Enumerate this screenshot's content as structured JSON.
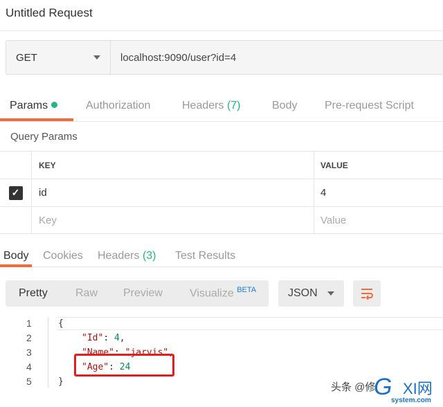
{
  "title": "Untitled Request",
  "request": {
    "method": "GET",
    "url": "localhost:9090/user?id=4"
  },
  "tabs": [
    {
      "label": "Params"
    },
    {
      "label": "Authorization"
    },
    {
      "label": "Headers",
      "count": "(7)"
    },
    {
      "label": "Body"
    },
    {
      "label": "Pre-request Script"
    }
  ],
  "query_params": {
    "title": "Query Params",
    "columns": [
      "KEY",
      "VALUE"
    ],
    "rows": [
      {
        "checked": true,
        "key": "id",
        "value": "4"
      }
    ],
    "placeholder": {
      "key": "Key",
      "value": "Value"
    }
  },
  "response_tabs": [
    {
      "label": "Body"
    },
    {
      "label": "Cookies"
    },
    {
      "label": "Headers",
      "count": "(3)"
    },
    {
      "label": "Test Results"
    }
  ],
  "view_modes": [
    "Pretty",
    "Raw",
    "Preview",
    "Visualize"
  ],
  "beta": "BETA",
  "format": "JSON",
  "code": {
    "line_numbers": [
      "1",
      "2",
      "3",
      "4",
      "5"
    ],
    "open": "{",
    "close": "}",
    "fields": [
      {
        "key": "\"Id\"",
        "value": "4",
        "comma": ","
      },
      {
        "key": "\"Name\"",
        "value": "\"jarvis\"",
        "comma": ","
      },
      {
        "key": "\"Age\"",
        "value": "24",
        "comma": ""
      }
    ]
  },
  "watermark": {
    "text": "头条 @修",
    "logo": "GXI网",
    "logo_sub": "system.com"
  },
  "colors": {
    "accent": "#f26b3a",
    "green": "#26b47f",
    "highlight": "#e02020"
  }
}
